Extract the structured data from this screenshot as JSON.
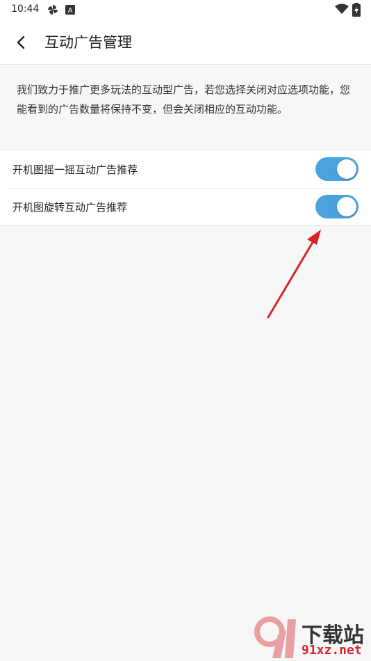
{
  "status_bar": {
    "time": "10:44",
    "icons": [
      "pinwheel-icon",
      "a-badge-icon",
      "wifi-icon",
      "battery-charging-icon"
    ]
  },
  "app_bar": {
    "back_icon": "chevron-left-icon",
    "title": "互动广告管理"
  },
  "intro": {
    "text": "我们致力于推广更多玩法的互动型广告，若您选择关闭对应选项功能，您能看到的广告数量将保持不变，但会关闭相应的互动功能。"
  },
  "settings": {
    "items": [
      {
        "label": "开机图摇一摇互动广告推荐",
        "enabled": true
      },
      {
        "label": "开机图旋转互动广告推荐",
        "enabled": true
      }
    ]
  },
  "colors": {
    "accent": "#4aa3df",
    "annotation_arrow": "#d6242a"
  },
  "watermark": {
    "title": "下载站",
    "site": "91xz.net"
  }
}
